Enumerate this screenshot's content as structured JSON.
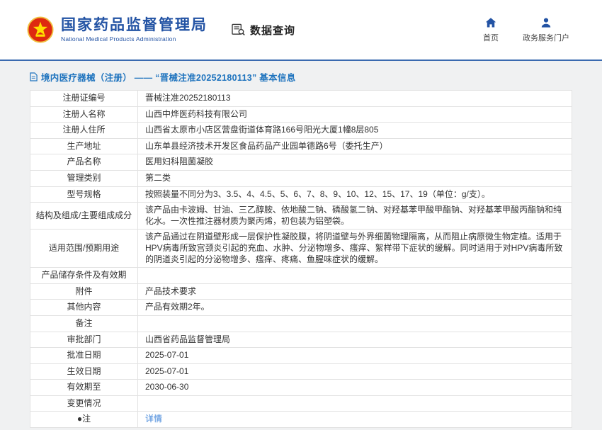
{
  "header": {
    "org_cn": "国家药品监督管理局",
    "org_en": "National Medical Products Administration",
    "data_query": "数据查询",
    "home": "首页",
    "portal": "政务服务门户"
  },
  "page": {
    "title": "境内医疗器械（注册） —— “晋械注准20252180113” 基本信息"
  },
  "colors": {
    "brand_blue": "#2353a4",
    "title_blue": "#1e73be",
    "link_blue": "#3b82d8",
    "emblem_red": "#de2910",
    "emblem_gold": "#ffde00"
  },
  "table": {
    "rows": [
      {
        "label": "注册证编号",
        "value": "晋械注准20252180113"
      },
      {
        "label": "注册人名称",
        "value": "山西中烨医药科技有限公司"
      },
      {
        "label": "注册人住所",
        "value": "山西省太原市小店区营盘街道体育路166号阳光大厦1幢8层805"
      },
      {
        "label": "生产地址",
        "value": "山东单县经济技术开发区食品药品产业园单德路6号（委托生产）"
      },
      {
        "label": "产品名称",
        "value": "医用妇科阻菌凝胶"
      },
      {
        "label": "管理类别",
        "value": "第二类"
      },
      {
        "label": "型号规格",
        "value": "按照装量不同分为3、3.5、4、4.5、5、6、7、8、9、10、12、15、17、19（单位：g/支）。"
      },
      {
        "label": "结构及组成/主要组成成分",
        "value": "该产品由卡波姆、甘油、三乙醇胺、依地酸二钠、磷酸氢二钠、对羟基苯甲酸甲酯钠、对羟基苯甲酸丙酯钠和纯化水。一次性推注器材质为聚丙烯，初包装为铝塑袋。"
      },
      {
        "label": "适用范围/预期用途",
        "value": "该产品通过在阴道壁形成一层保护性凝胶膜，将阴道壁与外界细菌物理隔离，从而阻止病原微生物定植。适用于HPV病毒所致宫颈炎引起的充血、水肿、分泌物增多、瘙痒、絮样带下症状的缓解。同时适用于对HPV病毒所致的阴道炎引起的分泌物增多、瘙痒、疼痛、鱼腥味症状的缓解。"
      },
      {
        "label": "产品储存条件及有效期",
        "value": ""
      },
      {
        "label": "附件",
        "value": "产品技术要求"
      },
      {
        "label": "其他内容",
        "value": "产品有效期2年。"
      },
      {
        "label": "备注",
        "value": ""
      },
      {
        "label": "审批部门",
        "value": "山西省药品监督管理局"
      },
      {
        "label": "批准日期",
        "value": "2025-07-01"
      },
      {
        "label": "生效日期",
        "value": "2025-07-01"
      },
      {
        "label": "有效期至",
        "value": "2030-06-30"
      },
      {
        "label": "变更情况",
        "value": ""
      },
      {
        "label": "●注",
        "value": "详情",
        "link": true
      }
    ]
  }
}
